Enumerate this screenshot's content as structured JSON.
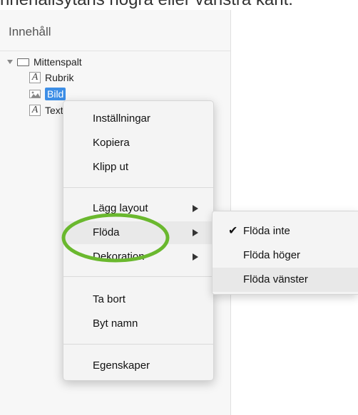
{
  "top_caption": "nnehållsytans högra eller vänstra kant.",
  "sidebar": {
    "title": "Innehåll",
    "tree": {
      "root_label": "Mittenspalt",
      "children": [
        {
          "label": "Rubrik",
          "type": "text"
        },
        {
          "label": "Bild",
          "type": "image",
          "selected": true
        },
        {
          "label": "Text",
          "type": "text"
        }
      ]
    }
  },
  "context_menu": {
    "items": [
      {
        "label": "Inställningar"
      },
      {
        "label": "Kopiera"
      },
      {
        "label": "Klipp ut"
      },
      {
        "label": "Lägg layout",
        "has_submenu": true
      },
      {
        "label": "Flöda",
        "has_submenu": true,
        "active": true
      },
      {
        "label": "Dekoration",
        "has_submenu": true
      },
      {
        "label": "Ta bort"
      },
      {
        "label": "Byt namn"
      },
      {
        "label": "Egenskaper"
      }
    ]
  },
  "submenu": {
    "items": [
      {
        "label": "Flöda inte",
        "checked": true
      },
      {
        "label": "Flöda höger"
      },
      {
        "label": "Flöda vänster",
        "highlighted": true
      }
    ],
    "check_glyph": "✔"
  },
  "colors": {
    "selection": "#3d8ee6",
    "annotation": "#6ab82e"
  }
}
